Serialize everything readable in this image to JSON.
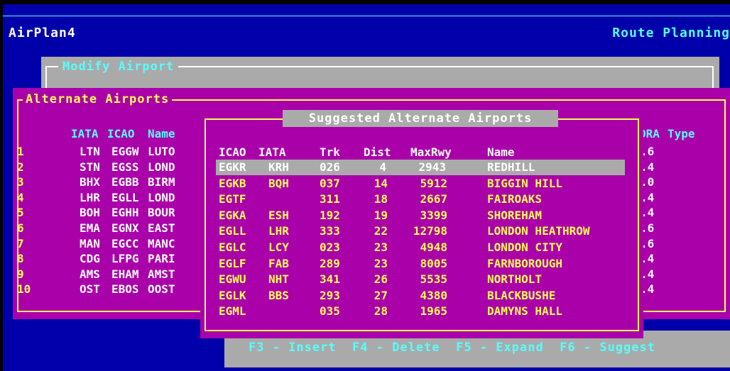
{
  "app": {
    "title": "AirPlan4",
    "screen": "Route Planning"
  },
  "modify_panel": {
    "title": "Modify Airport"
  },
  "alternate_panel": {
    "title": "Alternate Airports",
    "headers": {
      "iata": "IATA",
      "icao": "ICAO",
      "name": "Name",
      "ora": "ORA",
      "type": "Type"
    },
    "rows": [
      {
        "idx": "1",
        "iata": "LTN",
        "icao": "EGGW",
        "name": "LUTO",
        "ora": ".6"
      },
      {
        "idx": "2",
        "iata": "STN",
        "icao": "EGSS",
        "name": "LOND",
        "ora": ".4"
      },
      {
        "idx": "3",
        "iata": "BHX",
        "icao": "EGBB",
        "name": "BIRM",
        "ora": ".0"
      },
      {
        "idx": "4",
        "iata": "LHR",
        "icao": "EGLL",
        "name": "LOND",
        "ora": ".4"
      },
      {
        "idx": "5",
        "iata": "BOH",
        "icao": "EGHH",
        "name": "BOUR",
        "ora": ".4"
      },
      {
        "idx": "6",
        "iata": "EMA",
        "icao": "EGNX",
        "name": "EAST",
        "ora": ".6"
      },
      {
        "idx": "7",
        "iata": "MAN",
        "icao": "EGCC",
        "name": "MANC",
        "ora": ".6"
      },
      {
        "idx": "8",
        "iata": "CDG",
        "icao": "LFPG",
        "name": "PARI",
        "ora": ".4"
      },
      {
        "idx": "9",
        "iata": "AMS",
        "icao": "EHAM",
        "name": "AMST",
        "ora": ".4"
      },
      {
        "idx": "10",
        "iata": "OST",
        "icao": "EBOS",
        "name": "OOST",
        "ora": ".4"
      }
    ]
  },
  "suggest_panel": {
    "title": "Suggested Alternate Airports",
    "headers": {
      "icao": "ICAO",
      "iata": "IATA",
      "trk": "Trk",
      "dist": "Dist",
      "maxrwy": "MaxRwy",
      "name": "Name"
    },
    "rows": [
      {
        "icao": "EGKR",
        "iata": "KRH",
        "trk": "026",
        "dist": "4",
        "maxrwy": "2943",
        "name": "REDHILL"
      },
      {
        "icao": "EGKB",
        "iata": "BQH",
        "trk": "037",
        "dist": "14",
        "maxrwy": "5912",
        "name": "BIGGIN HILL"
      },
      {
        "icao": "EGTF",
        "iata": "",
        "trk": "311",
        "dist": "18",
        "maxrwy": "2667",
        "name": "FAIROAKS"
      },
      {
        "icao": "EGKA",
        "iata": "ESH",
        "trk": "192",
        "dist": "19",
        "maxrwy": "3399",
        "name": "SHOREHAM"
      },
      {
        "icao": "EGLL",
        "iata": "LHR",
        "trk": "333",
        "dist": "22",
        "maxrwy": "12798",
        "name": "LONDON HEATHROW"
      },
      {
        "icao": "EGLC",
        "iata": "LCY",
        "trk": "023",
        "dist": "23",
        "maxrwy": "4948",
        "name": "LONDON CITY"
      },
      {
        "icao": "EGLF",
        "iata": "FAB",
        "trk": "289",
        "dist": "23",
        "maxrwy": "8005",
        "name": "FARNBOROUGH"
      },
      {
        "icao": "EGWU",
        "iata": "NHT",
        "trk": "341",
        "dist": "26",
        "maxrwy": "5535",
        "name": "NORTHOLT"
      },
      {
        "icao": "EGLK",
        "iata": "BBS",
        "trk": "293",
        "dist": "27",
        "maxrwy": "4380",
        "name": "BLACKBUSHE"
      },
      {
        "icao": "EGML",
        "iata": "",
        "trk": "035",
        "dist": "28",
        "maxrwy": "1965",
        "name": "DAMYNS HALL"
      }
    ]
  },
  "function_keys": "F3 - Insert  F4 - Delete  F5 - Expand  F6 - Suggest"
}
